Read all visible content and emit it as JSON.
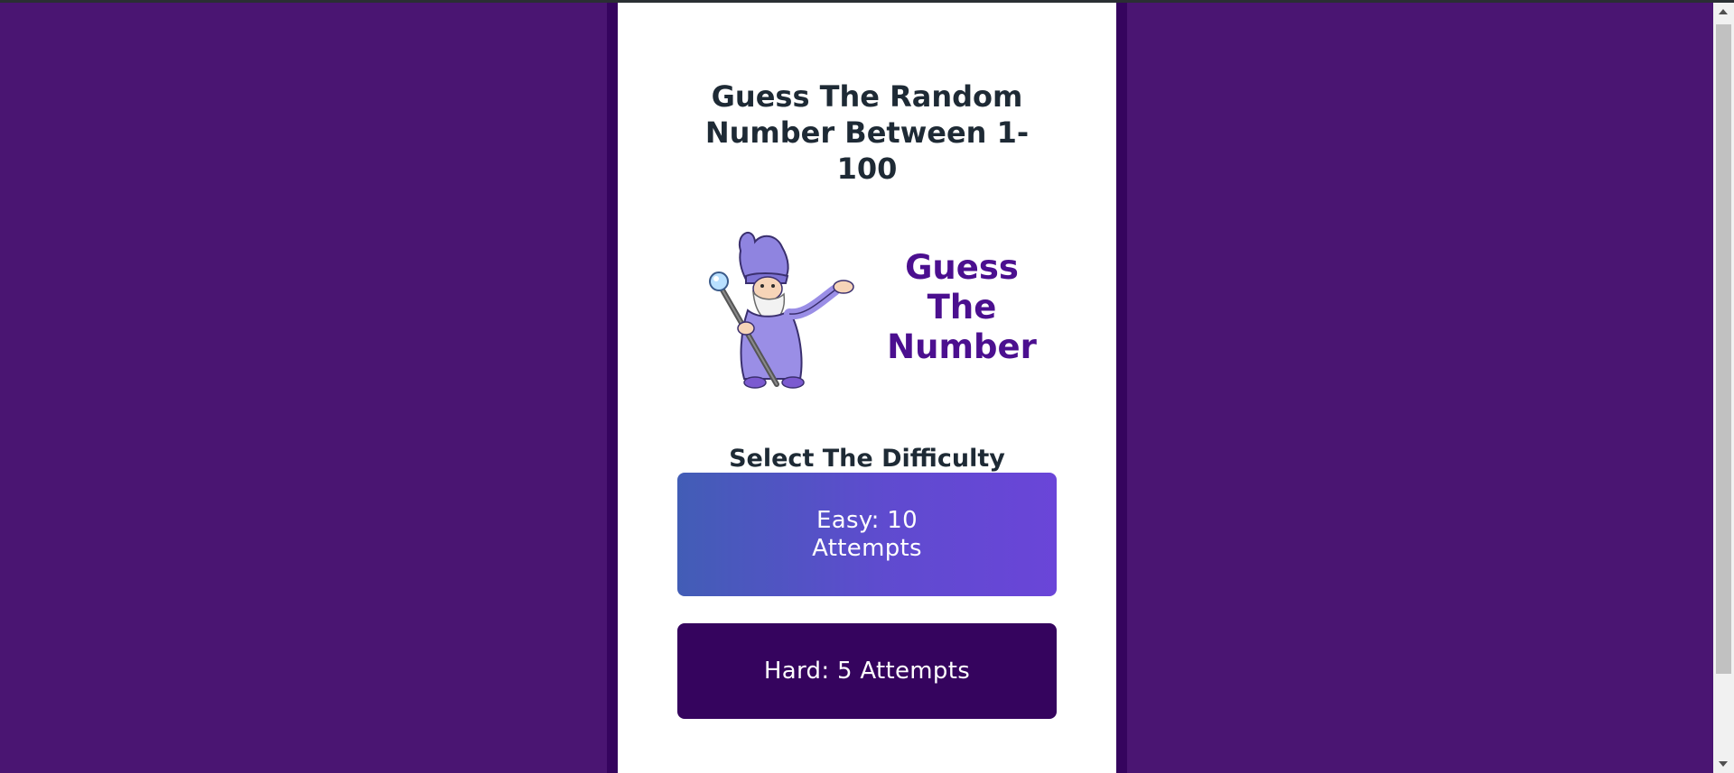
{
  "page": {
    "background_color": "#4a1572",
    "frame_color": "#35045e",
    "card_color": "#ffffff"
  },
  "header": {
    "title_lines": [
      "Guess The Random",
      "Number Between 1-",
      "100"
    ]
  },
  "logo": {
    "icon": "wizard-mascot-icon",
    "text_lines": [
      "Guess",
      "The",
      "Number"
    ],
    "text_color": "#4b0f8f"
  },
  "difficulty": {
    "title": "Select The Difficulty",
    "easy": {
      "label_lines": [
        "Easy: 10",
        "Attempts"
      ],
      "gradient": [
        "#425db6",
        "#6a45d8"
      ]
    },
    "hard": {
      "label": "Hard: 5 Attempts",
      "color": "#35045e"
    }
  },
  "scrollbar": {
    "up_icon": "scroll-up-arrow-icon",
    "down_icon": "scroll-down-arrow-icon"
  }
}
